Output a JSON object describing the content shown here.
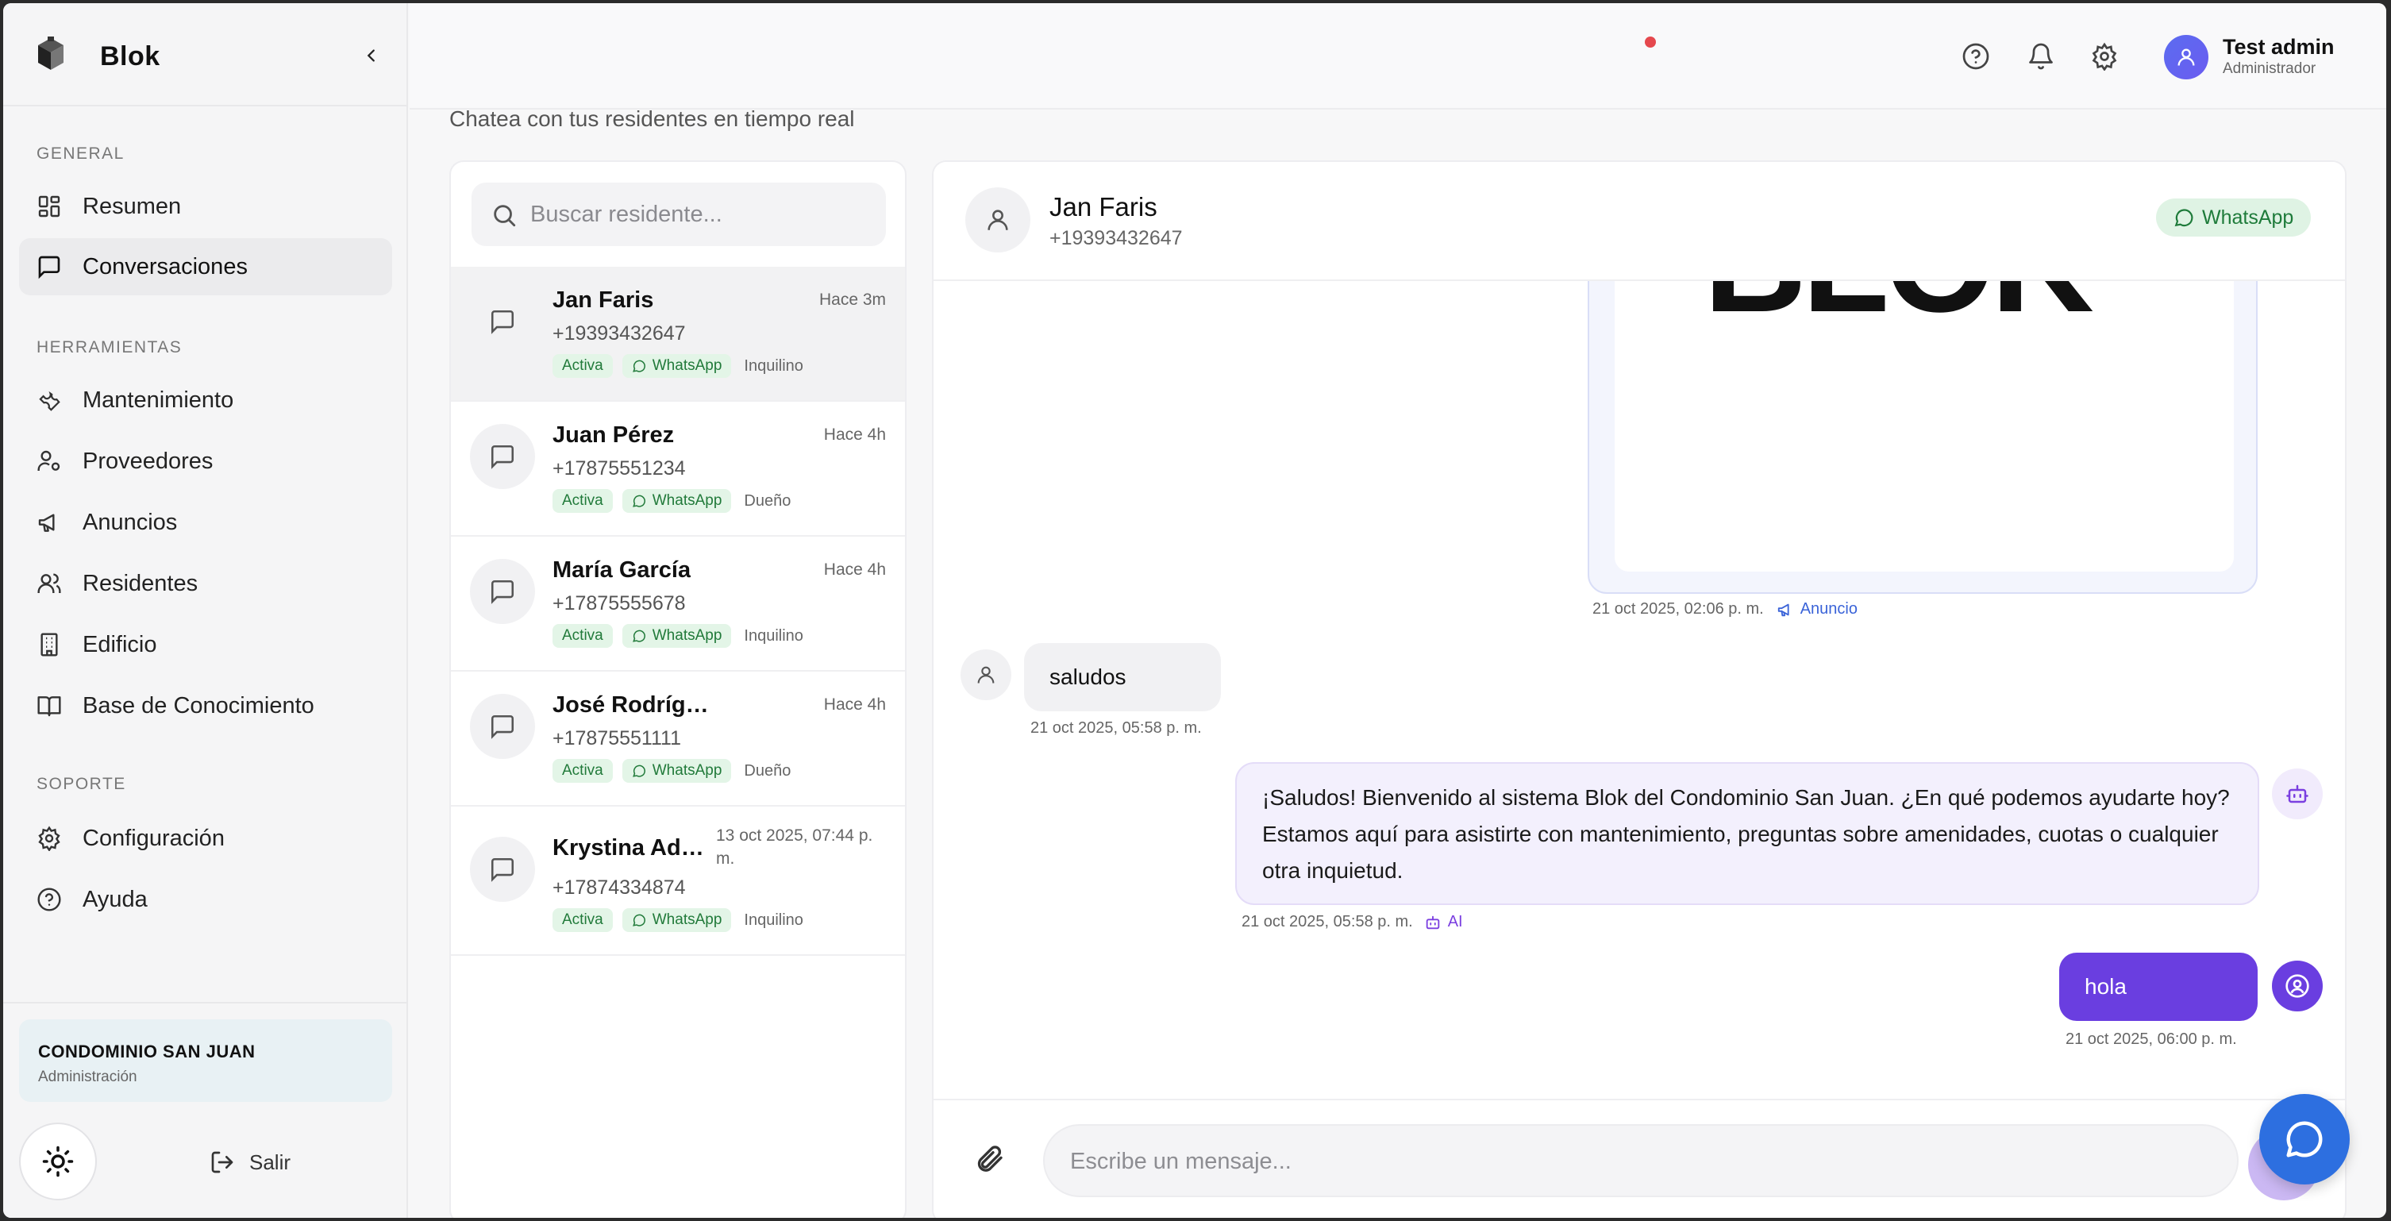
{
  "app": {
    "name": "Blok"
  },
  "sidebar": {
    "sections": {
      "general": "GENERAL",
      "tools": "HERRAMIENTAS",
      "support": "SOPORTE"
    },
    "items": [
      {
        "label": "Resumen",
        "icon": "dashboard-icon"
      },
      {
        "label": "Conversaciones",
        "icon": "message-square-icon",
        "active": true
      },
      {
        "label": "Mantenimiento",
        "icon": "wrench-icon"
      },
      {
        "label": "Proveedores",
        "icon": "user-cog-icon"
      },
      {
        "label": "Anuncios",
        "icon": "megaphone-icon"
      },
      {
        "label": "Residentes",
        "icon": "users-icon"
      },
      {
        "label": "Edificio",
        "icon": "building-icon"
      },
      {
        "label": "Base de Conocimiento",
        "icon": "book-open-icon"
      },
      {
        "label": "Configuración",
        "icon": "gear-icon"
      },
      {
        "label": "Ayuda",
        "icon": "help-circle-icon"
      }
    ],
    "condo": {
      "name": "CONDOMINIO SAN JUAN",
      "role": "Administración"
    },
    "logout_label": "Salir"
  },
  "topbar": {
    "user_name": "Test admin",
    "user_role": "Administrador"
  },
  "page": {
    "subtitle": "Chatea con tus residentes en tiempo real"
  },
  "search": {
    "placeholder": "Buscar residente..."
  },
  "conversations": [
    {
      "name": "Jan Faris",
      "time": "Hace 3m",
      "phone": "+19393432647",
      "status": "Activa",
      "channel": "WhatsApp",
      "role": "Inquilino",
      "active": true
    },
    {
      "name": "Juan Pérez",
      "time": "Hace 4h",
      "phone": "+17875551234",
      "status": "Activa",
      "channel": "WhatsApp",
      "role": "Dueño"
    },
    {
      "name": "María García",
      "time": "Hace 4h",
      "phone": "+17875555678",
      "status": "Activa",
      "channel": "WhatsApp",
      "role": "Inquilino"
    },
    {
      "name": "José Rodríguez",
      "time": "Hace 4h",
      "phone": "+17875551111",
      "status": "Activa",
      "channel": "WhatsApp",
      "role": "Dueño"
    },
    {
      "name": "Krystina Ado...",
      "time": "13 oct 2025, 07:44 p. m.",
      "phone": "+17874334874",
      "status": "Activa",
      "channel": "WhatsApp",
      "role": "Inquilino"
    }
  ],
  "chat": {
    "contact_name": "Jan Faris",
    "contact_phone": "+19393432647",
    "channel_badge": "WhatsApp",
    "announcement": {
      "logo_text": "BLOK",
      "time": "21 oct 2025, 02:06 p. m.",
      "tag": "Anuncio"
    },
    "messages": [
      {
        "from": "resident",
        "text": "saludos",
        "time": "21 oct 2025, 05:58 p. m."
      },
      {
        "from": "ai",
        "text": "¡Saludos! Bienvenido al sistema Blok del Condominio San Juan. ¿En qué podemos ayudarte hoy? Estamos aquí para asistirte con mantenimiento, preguntas sobre amenidades, cuotas o cualquier otra inquietud.",
        "time": "21 oct 2025, 05:58 p. m.",
        "tag": "AI"
      },
      {
        "from": "admin",
        "text": "hola",
        "time": "21 oct 2025, 06:00 p. m."
      }
    ],
    "composer_placeholder": "Escribe un mensaje..."
  },
  "colors": {
    "accent_purple": "#6a3ee0",
    "whatsapp_green": "#1e7b3a",
    "notification_red": "#e5484d",
    "fab_blue": "#2d6fe0"
  }
}
